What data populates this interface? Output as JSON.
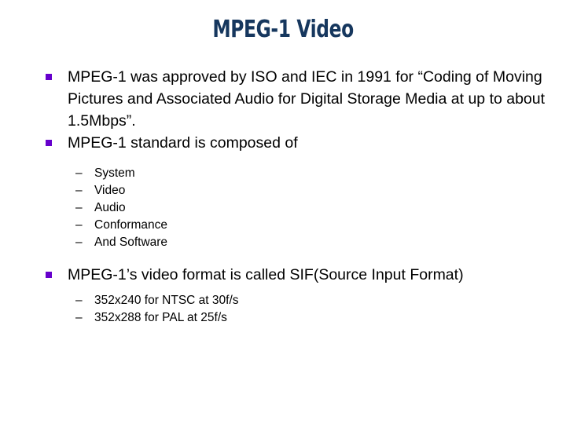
{
  "slide": {
    "title": "MPEG-1 Video",
    "title_color": "#16375E",
    "background_color": "#FFFFFF",
    "bullet_color": "#6600CC",
    "text_color": "#000000",
    "bullets": [
      {
        "marker": "square-bullet",
        "text": "MPEG-1 was approved by ISO and IEC in 1991 for “Coding of Moving Pictures and Associated Audio for Digital Storage Media at up to about 1.5Mbps”."
      },
      {
        "marker": "square-bullet",
        "text": "MPEG-1 standard is composed of"
      },
      {
        "marker": "square-bullet",
        "text": "MPEG-1’s video format is called SIF(Source Input Format)"
      }
    ],
    "sublist_components": {
      "dash": "–",
      "items": [
        "System",
        "Video",
        "Audio",
        "Conformance",
        "And Software"
      ]
    },
    "sublist_formats": {
      "dash": "–",
      "items": [
        "352x240 for NTSC at 30f/s",
        "352x288 for PAL at 25f/s"
      ]
    }
  }
}
